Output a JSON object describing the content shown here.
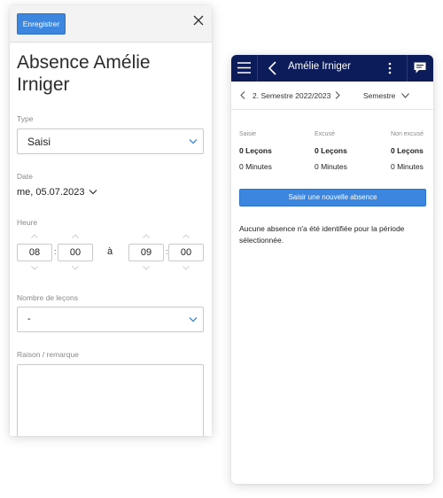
{
  "form": {
    "save_label": "Enregistrer",
    "title": "Absence Amélie Irniger",
    "type_label": "Type",
    "type_value": "Saisi",
    "date_label": "Date",
    "date_value": "me, 05.07.2023",
    "time_label": "Heure",
    "start_hour": "08",
    "start_minute": "00",
    "separator": "à",
    "end_hour": "09",
    "end_minute": "00",
    "time_colon": ":",
    "lessons_label": "Nombre de leçons",
    "lessons_value": "-",
    "reason_label": "Raison / remarque",
    "reason_value": ""
  },
  "mobile": {
    "title": "Amélie Irniger",
    "semester_value": "2. Semestre 2022/2023",
    "period_type": "Semestre",
    "stats": [
      {
        "label": "Saisie",
        "lessons": "0 Leçons",
        "minutes": "0 Minutes"
      },
      {
        "label": "Excusé",
        "lessons": "0 Leçons",
        "minutes": "0 Minutes"
      },
      {
        "label": "Non excusé",
        "lessons": "0 Leçons",
        "minutes": "0 Minutes"
      }
    ],
    "new_absence_label": "Saisir une nouvelle absence",
    "empty_message": "Aucune absence n'a été identifiée pour la période sélectionnée."
  },
  "colors": {
    "accent": "#3c86e0",
    "topbar": "#0c1c5a"
  },
  "icons": {
    "close": "close-icon",
    "dropdown": "chevron-down-icon",
    "menu": "hamburger-menu-icon",
    "back": "chevron-left-icon",
    "more": "more-vertical-icon",
    "chat": "chat-bubble-icon"
  }
}
